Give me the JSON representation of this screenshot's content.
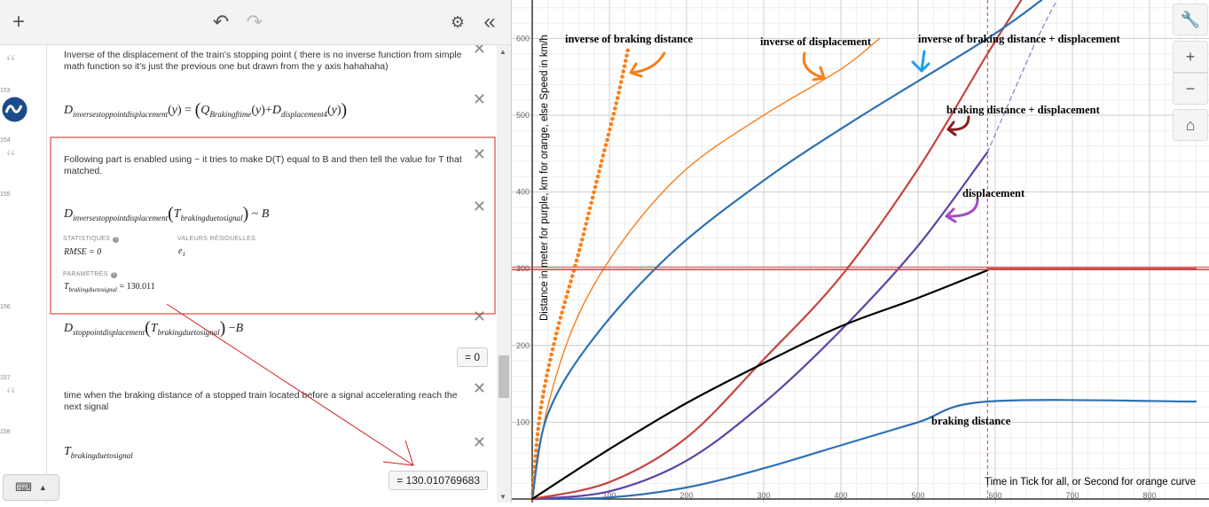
{
  "toolbar": {
    "add_icon": "+",
    "undo_icon": "↶",
    "redo_icon": "↷",
    "settings_icon": "⚙",
    "collapse_icon": "«"
  },
  "expressions": [
    {
      "num": "",
      "type": "note",
      "text": "Inverse of the displacement of the train's stopping point ( there is no inverse function from simple math function so it's just the previous one but drawn from the y axis hahahaha)"
    },
    {
      "num": "153",
      "type": "expr"
    },
    {
      "num": "154",
      "type": "note",
      "text": "Following part is enabled using ~ it tries to make D(T) equal to B and then tell the value for T that matched."
    },
    {
      "num": "155",
      "type": "regression",
      "stats_label": "STATISTIQUES",
      "residuals_label": "VALEURS RÉSIDUELLES",
      "rmse": "RMSE = 0",
      "residual": "e",
      "residual_sub": "1",
      "params_label": "PARAMÈTRES",
      "param_value": "= 130.011"
    },
    {
      "num": "156",
      "type": "expr",
      "result": "= 0"
    },
    {
      "num": "157",
      "type": "note",
      "text": "time when the braking distance of a stopped train located before a signal accelerating reach the next signal"
    },
    {
      "num": "158",
      "type": "expr",
      "result": "= 130.010769683"
    }
  ],
  "keyboard": {
    "icon": "⌨",
    "arrow": "▲"
  },
  "graph_controls": {
    "wrench": "🔧",
    "zoom_in": "+",
    "zoom_out": "−",
    "home": "⌂"
  },
  "chart_data": {
    "type": "line",
    "xlabel": "Time in Tick for all, or Second for orange curve",
    "ylabel": "Distance in meter for purple, km for orange, else Speed in km/h",
    "x_ticks": [
      100,
      200,
      300,
      400,
      500,
      600,
      700,
      800
    ],
    "y_ticks": [
      100,
      200,
      300,
      400,
      500,
      600
    ],
    "xlim": [
      0,
      860
    ],
    "ylim": [
      0,
      650
    ],
    "grid": true,
    "vertical_marker_x": 590,
    "horizontal_marker_y": 300,
    "series": [
      {
        "name": "braking distance",
        "color": "#2d70b3",
        "style": "solid",
        "points": [
          [
            0,
            0
          ],
          [
            100,
            2
          ],
          [
            200,
            15
          ],
          [
            300,
            40
          ],
          [
            400,
            70
          ],
          [
            500,
            100
          ],
          [
            590,
            127
          ],
          [
            860,
            127
          ]
        ]
      },
      {
        "name": "displacement",
        "color": "#6042a6",
        "style": "solid",
        "points": [
          [
            0,
            0
          ],
          [
            100,
            10
          ],
          [
            200,
            50
          ],
          [
            300,
            125
          ],
          [
            400,
            220
          ],
          [
            500,
            330
          ],
          [
            590,
            452
          ]
        ]
      },
      {
        "name": "braking distance + displacement",
        "color": "#c74440",
        "style": "solid",
        "points": [
          [
            0,
            0
          ],
          [
            100,
            22
          ],
          [
            200,
            80
          ],
          [
            300,
            182
          ],
          [
            400,
            290
          ],
          [
            500,
            430
          ],
          [
            590,
            580
          ],
          [
            640,
            660
          ]
        ]
      },
      {
        "name": "inverse of braking distance",
        "color": "#fa7e19",
        "style": "dotted",
        "points": [
          [
            0,
            0
          ],
          [
            10,
            110
          ],
          [
            30,
            210
          ],
          [
            60,
            320
          ],
          [
            90,
            440
          ],
          [
            110,
            520
          ],
          [
            125,
            590
          ]
        ]
      },
      {
        "name": "inverse of displacement",
        "color": "#fa7e19",
        "style": "solid",
        "points": [
          [
            0,
            0
          ],
          [
            20,
            120
          ],
          [
            60,
            240
          ],
          [
            120,
            340
          ],
          [
            200,
            430
          ],
          [
            300,
            500
          ],
          [
            400,
            560
          ],
          [
            450,
            600
          ]
        ]
      },
      {
        "name": "inverse of braking distance + displacement",
        "color": "#2d70b3",
        "style": "solid",
        "points": [
          [
            0,
            0
          ],
          [
            20,
            110
          ],
          [
            80,
            210
          ],
          [
            180,
            320
          ],
          [
            300,
            415
          ],
          [
            420,
            495
          ],
          [
            590,
            600
          ],
          [
            660,
            650
          ]
        ]
      },
      {
        "name": "",
        "color": "#000000",
        "style": "solid",
        "points": [
          [
            0,
            0
          ],
          [
            100,
            65
          ],
          [
            200,
            125
          ],
          [
            300,
            177
          ],
          [
            400,
            225
          ],
          [
            500,
            262
          ],
          [
            590,
            298
          ]
        ]
      },
      {
        "name": "",
        "color": "#c74440",
        "style": "solid",
        "points": [
          [
            590,
            300
          ],
          [
            860,
            300
          ]
        ]
      },
      {
        "name": "",
        "color": "#6042a6",
        "style": "dashed",
        "points": [
          [
            590,
            452
          ],
          [
            650,
            590
          ],
          [
            680,
            650
          ]
        ]
      }
    ],
    "annotations": [
      {
        "text": "inverse of braking distance",
        "color": "#000000"
      },
      {
        "text": "inverse of displacement",
        "color": "#000000"
      },
      {
        "text": "inverse of braking distance + displacement",
        "color": "#000000"
      },
      {
        "text": "braking distance + displacement",
        "color": "#000000"
      },
      {
        "text": "displacement",
        "color": "#000000"
      },
      {
        "text": "braking distance",
        "color": "#000000"
      }
    ]
  }
}
